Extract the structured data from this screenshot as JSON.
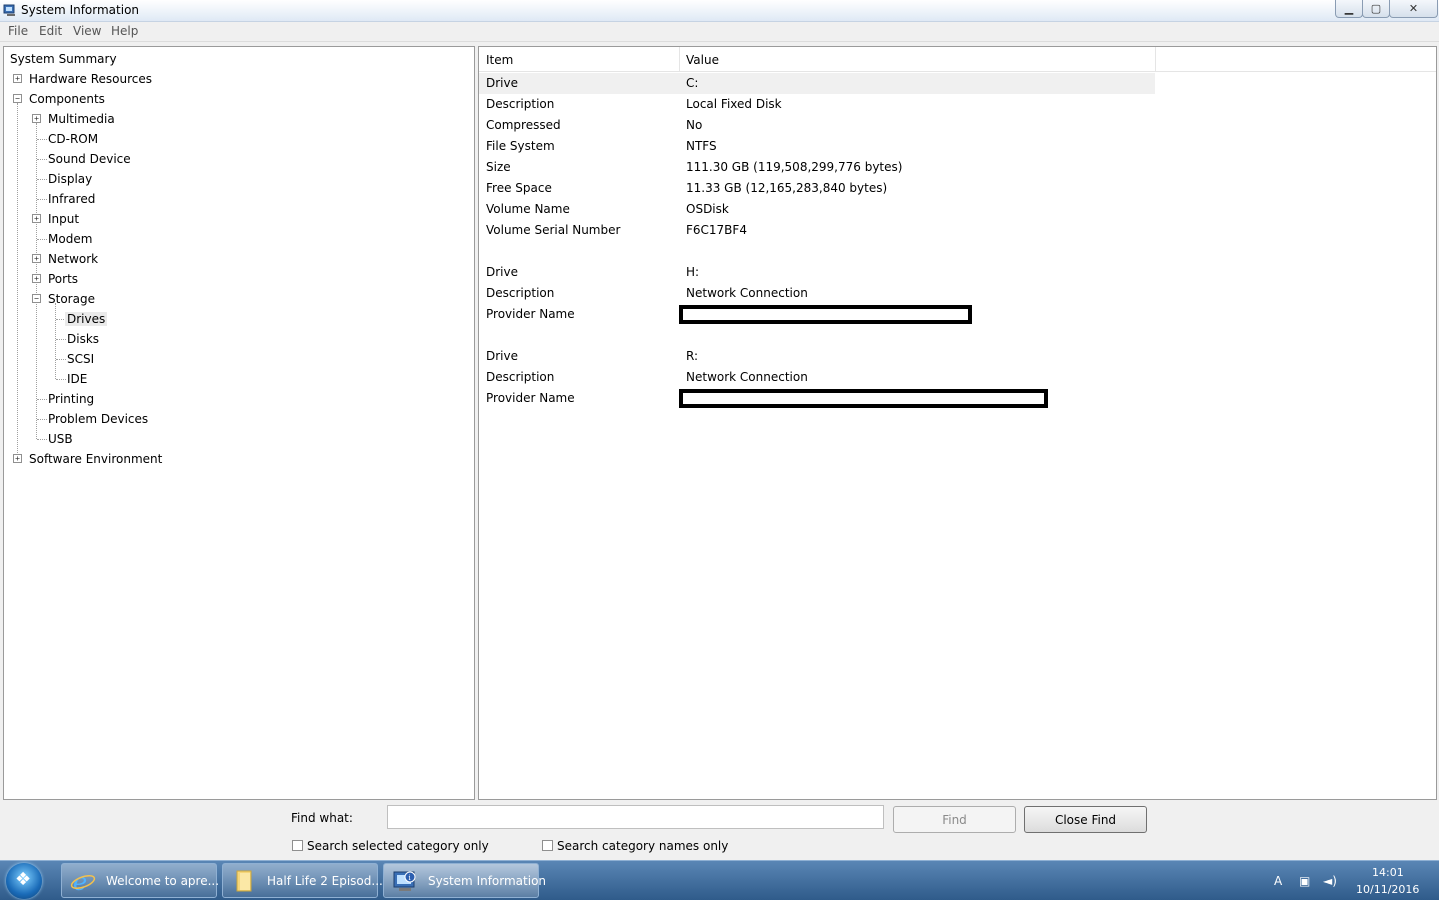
{
  "window": {
    "title": "System Information",
    "controls": {
      "minimize": "▁",
      "maximize": "▢",
      "close": "✕"
    }
  },
  "menu": [
    "File",
    "Edit",
    "View",
    "Help"
  ],
  "tree": {
    "system_summary": "System Summary",
    "hardware_resources": "Hardware Resources",
    "components": "Components",
    "multimedia": "Multimedia",
    "cdrom": "CD-ROM",
    "sound_device": "Sound Device",
    "display": "Display",
    "infrared": "Infrared",
    "input": "Input",
    "modem": "Modem",
    "network": "Network",
    "ports": "Ports",
    "storage": "Storage",
    "drives": "Drives",
    "disks": "Disks",
    "scsi": "SCSI",
    "ide": "IDE",
    "printing": "Printing",
    "problem_devices": "Problem Devices",
    "usb": "USB",
    "software_environment": "Software Environment",
    "plus": "+",
    "minus": "−"
  },
  "list": {
    "headers": {
      "item": "Item",
      "value": "Value"
    },
    "rows": [
      {
        "item": "Drive",
        "value": "C:"
      },
      {
        "item": "Description",
        "value": "Local Fixed Disk"
      },
      {
        "item": "Compressed",
        "value": "No"
      },
      {
        "item": "File System",
        "value": "NTFS"
      },
      {
        "item": "Size",
        "value": "111.30 GB (119,508,299,776 bytes)"
      },
      {
        "item": "Free Space",
        "value": "11.33 GB (12,165,283,840 bytes)"
      },
      {
        "item": "Volume Name",
        "value": "OSDisk"
      },
      {
        "item": "Volume Serial Number",
        "value": "F6C17BF4"
      },
      {
        "item": "Drive",
        "value": "H:"
      },
      {
        "item": "Description",
        "value": "Network Connection"
      },
      {
        "item": "Provider Name",
        "value": ""
      },
      {
        "item": "Drive",
        "value": "R:"
      },
      {
        "item": "Description",
        "value": "Network Connection"
      },
      {
        "item": "Provider Name",
        "value": ""
      }
    ]
  },
  "find": {
    "label": "Find what:",
    "value": "",
    "find_button": "Find",
    "close_button": "Close Find",
    "option_selected_category": "Search selected category only",
    "option_category_names": "Search category names only"
  },
  "taskbar": {
    "tasks": [
      {
        "label": "Welcome to apre..."
      },
      {
        "label": "Half Life 2 Episod..."
      },
      {
        "label": "System Information"
      }
    ],
    "tray": {
      "time": "14:01",
      "date": "10/11/2016"
    }
  }
}
